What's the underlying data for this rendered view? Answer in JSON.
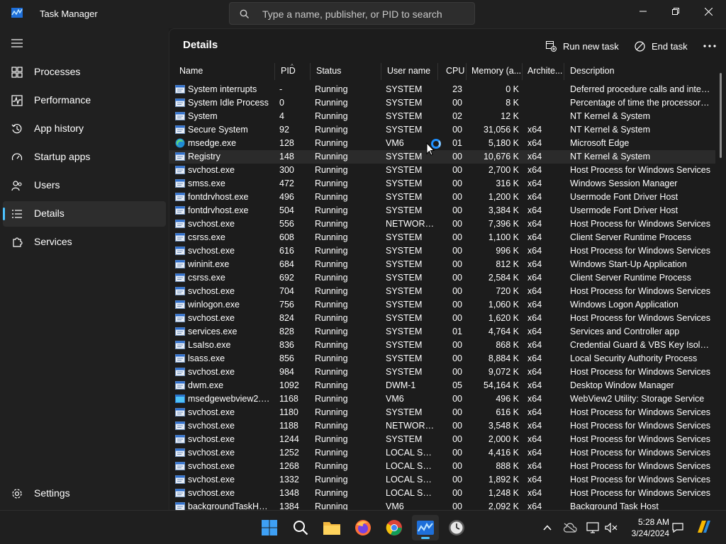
{
  "window": {
    "title": "Task Manager",
    "search_placeholder": "Type a name, publisher, or PID to search"
  },
  "sidebar": {
    "items": [
      {
        "label": "Processes",
        "icon": "grid-icon"
      },
      {
        "label": "Performance",
        "icon": "pulse-icon"
      },
      {
        "label": "App history",
        "icon": "history-icon"
      },
      {
        "label": "Startup apps",
        "icon": "speedometer-icon"
      },
      {
        "label": "Users",
        "icon": "users-icon"
      },
      {
        "label": "Details",
        "icon": "list-icon",
        "active": true
      },
      {
        "label": "Services",
        "icon": "puzzle-icon"
      }
    ],
    "settings_label": "Settings"
  },
  "main": {
    "title": "Details",
    "run_new_task_label": "Run new task",
    "end_task_label": "End task"
  },
  "table": {
    "columns": [
      "Name",
      "PID",
      "Status",
      "User name",
      "CPU",
      "Memory (a...",
      "Archite...",
      "Description"
    ],
    "rows": [
      {
        "name": "System interrupts",
        "pid": "-",
        "status": "Running",
        "user": "SYSTEM",
        "cpu": "23",
        "mem": "0 K",
        "arch": "",
        "desc": "Deferred procedure calls and interr...",
        "icon": "window"
      },
      {
        "name": "System Idle Process",
        "pid": "0",
        "status": "Running",
        "user": "SYSTEM",
        "cpu": "00",
        "mem": "8 K",
        "arch": "",
        "desc": "Percentage of time the processor is...",
        "icon": "window"
      },
      {
        "name": "System",
        "pid": "4",
        "status": "Running",
        "user": "SYSTEM",
        "cpu": "02",
        "mem": "12 K",
        "arch": "",
        "desc": "NT Kernel & System",
        "icon": "window"
      },
      {
        "name": "Secure System",
        "pid": "92",
        "status": "Running",
        "user": "SYSTEM",
        "cpu": "00",
        "mem": "31,056 K",
        "arch": "x64",
        "desc": "NT Kernel & System",
        "icon": "window"
      },
      {
        "name": "msedge.exe",
        "pid": "128",
        "status": "Running",
        "user": "VM6",
        "cpu": "01",
        "mem": "5,180 K",
        "arch": "x64",
        "desc": "Microsoft Edge",
        "icon": "edge"
      },
      {
        "name": "Registry",
        "pid": "148",
        "status": "Running",
        "user": "SYSTEM",
        "cpu": "00",
        "mem": "10,676 K",
        "arch": "x64",
        "desc": "NT Kernel & System",
        "icon": "window",
        "hover": true
      },
      {
        "name": "svchost.exe",
        "pid": "300",
        "status": "Running",
        "user": "SYSTEM",
        "cpu": "00",
        "mem": "2,700 K",
        "arch": "x64",
        "desc": "Host Process for Windows Services",
        "icon": "window"
      },
      {
        "name": "smss.exe",
        "pid": "472",
        "status": "Running",
        "user": "SYSTEM",
        "cpu": "00",
        "mem": "316 K",
        "arch": "x64",
        "desc": "Windows Session Manager",
        "icon": "window"
      },
      {
        "name": "fontdrvhost.exe",
        "pid": "496",
        "status": "Running",
        "user": "SYSTEM",
        "cpu": "00",
        "mem": "1,200 K",
        "arch": "x64",
        "desc": "Usermode Font Driver Host",
        "icon": "window"
      },
      {
        "name": "fontdrvhost.exe",
        "pid": "504",
        "status": "Running",
        "user": "SYSTEM",
        "cpu": "00",
        "mem": "3,384 K",
        "arch": "x64",
        "desc": "Usermode Font Driver Host",
        "icon": "window"
      },
      {
        "name": "svchost.exe",
        "pid": "556",
        "status": "Running",
        "user": "NETWORK...",
        "cpu": "00",
        "mem": "7,396 K",
        "arch": "x64",
        "desc": "Host Process for Windows Services",
        "icon": "window"
      },
      {
        "name": "csrss.exe",
        "pid": "608",
        "status": "Running",
        "user": "SYSTEM",
        "cpu": "00",
        "mem": "1,100 K",
        "arch": "x64",
        "desc": "Client Server Runtime Process",
        "icon": "window"
      },
      {
        "name": "svchost.exe",
        "pid": "616",
        "status": "Running",
        "user": "SYSTEM",
        "cpu": "00",
        "mem": "996 K",
        "arch": "x64",
        "desc": "Host Process for Windows Services",
        "icon": "window"
      },
      {
        "name": "wininit.exe",
        "pid": "684",
        "status": "Running",
        "user": "SYSTEM",
        "cpu": "00",
        "mem": "812 K",
        "arch": "x64",
        "desc": "Windows Start-Up Application",
        "icon": "window"
      },
      {
        "name": "csrss.exe",
        "pid": "692",
        "status": "Running",
        "user": "SYSTEM",
        "cpu": "00",
        "mem": "2,584 K",
        "arch": "x64",
        "desc": "Client Server Runtime Process",
        "icon": "window"
      },
      {
        "name": "svchost.exe",
        "pid": "704",
        "status": "Running",
        "user": "SYSTEM",
        "cpu": "00",
        "mem": "720 K",
        "arch": "x64",
        "desc": "Host Process for Windows Services",
        "icon": "window"
      },
      {
        "name": "winlogon.exe",
        "pid": "756",
        "status": "Running",
        "user": "SYSTEM",
        "cpu": "00",
        "mem": "1,060 K",
        "arch": "x64",
        "desc": "Windows Logon Application",
        "icon": "window"
      },
      {
        "name": "svchost.exe",
        "pid": "824",
        "status": "Running",
        "user": "SYSTEM",
        "cpu": "00",
        "mem": "1,620 K",
        "arch": "x64",
        "desc": "Host Process for Windows Services",
        "icon": "window"
      },
      {
        "name": "services.exe",
        "pid": "828",
        "status": "Running",
        "user": "SYSTEM",
        "cpu": "01",
        "mem": "4,764 K",
        "arch": "x64",
        "desc": "Services and Controller app",
        "icon": "window"
      },
      {
        "name": "LsaIso.exe",
        "pid": "836",
        "status": "Running",
        "user": "SYSTEM",
        "cpu": "00",
        "mem": "868 K",
        "arch": "x64",
        "desc": "Credential Guard & VBS Key Isolation",
        "icon": "window"
      },
      {
        "name": "lsass.exe",
        "pid": "856",
        "status": "Running",
        "user": "SYSTEM",
        "cpu": "00",
        "mem": "8,884 K",
        "arch": "x64",
        "desc": "Local Security Authority Process",
        "icon": "window"
      },
      {
        "name": "svchost.exe",
        "pid": "984",
        "status": "Running",
        "user": "SYSTEM",
        "cpu": "00",
        "mem": "9,072 K",
        "arch": "x64",
        "desc": "Host Process for Windows Services",
        "icon": "window"
      },
      {
        "name": "dwm.exe",
        "pid": "1092",
        "status": "Running",
        "user": "DWM-1",
        "cpu": "05",
        "mem": "54,164 K",
        "arch": "x64",
        "desc": "Desktop Window Manager",
        "icon": "window"
      },
      {
        "name": "msedgewebview2.exe",
        "pid": "1168",
        "status": "Running",
        "user": "VM6",
        "cpu": "00",
        "mem": "496 K",
        "arch": "x64",
        "desc": "WebView2 Utility: Storage Service",
        "icon": "webview"
      },
      {
        "name": "svchost.exe",
        "pid": "1180",
        "status": "Running",
        "user": "SYSTEM",
        "cpu": "00",
        "mem": "616 K",
        "arch": "x64",
        "desc": "Host Process for Windows Services",
        "icon": "window"
      },
      {
        "name": "svchost.exe",
        "pid": "1188",
        "status": "Running",
        "user": "NETWORK...",
        "cpu": "00",
        "mem": "3,548 K",
        "arch": "x64",
        "desc": "Host Process for Windows Services",
        "icon": "window"
      },
      {
        "name": "svchost.exe",
        "pid": "1244",
        "status": "Running",
        "user": "SYSTEM",
        "cpu": "00",
        "mem": "2,000 K",
        "arch": "x64",
        "desc": "Host Process for Windows Services",
        "icon": "window"
      },
      {
        "name": "svchost.exe",
        "pid": "1252",
        "status": "Running",
        "user": "LOCAL SE...",
        "cpu": "00",
        "mem": "4,416 K",
        "arch": "x64",
        "desc": "Host Process for Windows Services",
        "icon": "window"
      },
      {
        "name": "svchost.exe",
        "pid": "1268",
        "status": "Running",
        "user": "LOCAL SE...",
        "cpu": "00",
        "mem": "888 K",
        "arch": "x64",
        "desc": "Host Process for Windows Services",
        "icon": "window"
      },
      {
        "name": "svchost.exe",
        "pid": "1332",
        "status": "Running",
        "user": "LOCAL SE...",
        "cpu": "00",
        "mem": "1,892 K",
        "arch": "x64",
        "desc": "Host Process for Windows Services",
        "icon": "window"
      },
      {
        "name": "svchost.exe",
        "pid": "1348",
        "status": "Running",
        "user": "LOCAL SE...",
        "cpu": "00",
        "mem": "1,248 K",
        "arch": "x64",
        "desc": "Host Process for Windows Services",
        "icon": "window"
      },
      {
        "name": "backgroundTaskHos...",
        "pid": "1384",
        "status": "Running",
        "user": "VM6",
        "cpu": "00",
        "mem": "2,092 K",
        "arch": "x64",
        "desc": "Background Task Host",
        "icon": "window"
      }
    ]
  },
  "taskbar": {
    "apps": [
      "start-icon",
      "search-icon",
      "file-explorer-icon",
      "firefox-icon",
      "chrome-icon",
      "task-manager-icon",
      "clock-app-icon"
    ],
    "time": "5:28 AM",
    "date": "3/24/2024"
  },
  "colors": {
    "accent": "#4cc2ff",
    "background": "#1c1c1c",
    "sidebar": "#202020"
  }
}
